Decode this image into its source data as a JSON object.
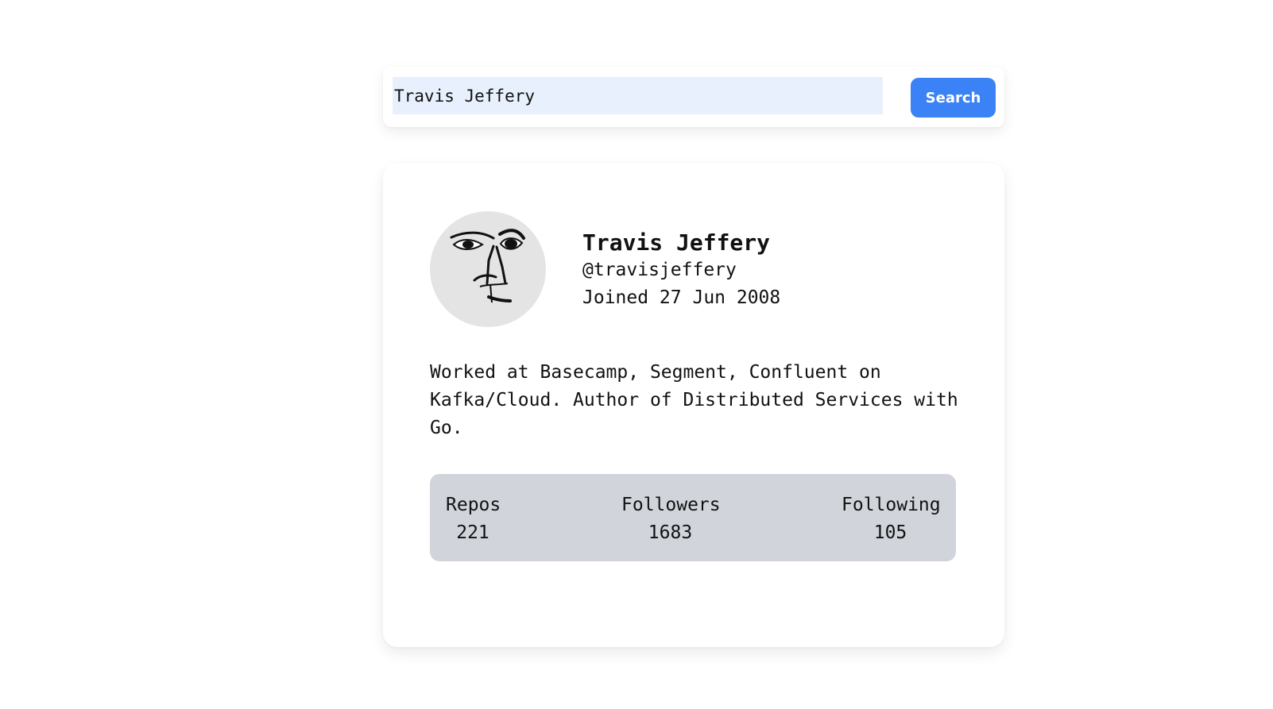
{
  "search": {
    "value": "Travis Jeffery",
    "button_label": "Search"
  },
  "profile": {
    "name": "Travis Jeffery",
    "handle": "@travisjeffery",
    "joined": "Joined 27 Jun 2008",
    "bio": "Worked at Basecamp, Segment, Confluent on Kafka/Cloud. Author of Distributed Services with Go.",
    "avatar_icon": "sketched-face-avatar"
  },
  "stats": {
    "repos": {
      "label": "Repos",
      "value": "221"
    },
    "followers": {
      "label": "Followers",
      "value": "1683"
    },
    "following": {
      "label": "Following",
      "value": "105"
    }
  },
  "colors": {
    "accent": "#3b82f6",
    "input_background": "#e8f0fe",
    "stats_background": "#d1d5db"
  }
}
